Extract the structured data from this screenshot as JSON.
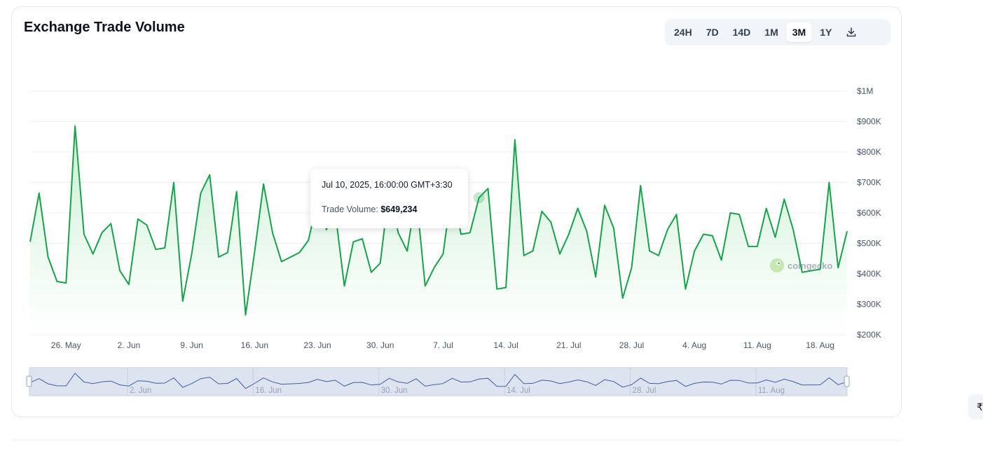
{
  "title": "Exchange Trade Volume",
  "range_buttons": [
    "24H",
    "7D",
    "14D",
    "1M",
    "3M",
    "1Y"
  ],
  "active_range": "3M",
  "tooltip": {
    "date": "Jul 10, 2025, 16:00:00 GMT+3:30",
    "label": "Trade Volume:",
    "value": "$649,234"
  },
  "watermark": "coingecko",
  "edge_glyph": "₹",
  "navigator_labels": [
    "2. Jun",
    "16. Jun",
    "30. Jun",
    "14. Jul",
    "28. Jul",
    "11. Aug"
  ],
  "colors": {
    "line": "#16a34a",
    "fill_top": "#d4f4dd",
    "navigator_bg": "#dde3ef",
    "navigator_line": "#3b5fa8"
  },
  "chart_data": {
    "type": "area",
    "series": [
      {
        "values": [
          505000,
          665000,
          455000,
          375000,
          370000,
          885000,
          530000,
          465000,
          535000,
          565000,
          410000,
          365000,
          580000,
          560000,
          480000,
          485000,
          700000,
          310000,
          465000,
          665000,
          725000,
          455000,
          470000,
          670000,
          265000,
          470000,
          695000,
          535000,
          440000,
          455000,
          470000,
          510000,
          640000,
          545000,
          600000,
          360000,
          505000,
          515000,
          405000,
          435000,
          680000,
          535000,
          475000,
          660000,
          360000,
          420000,
          465000,
          680000,
          530000,
          535000,
          650000,
          680000,
          350000,
          355000,
          840000,
          460000,
          475000,
          605000,
          570000,
          465000,
          530000,
          615000,
          540000,
          390000,
          625000,
          550000,
          320000,
          420000,
          690000,
          475000,
          460000,
          545000,
          595000,
          350000,
          475000,
          530000,
          525000,
          445000,
          600000,
          595000,
          490000,
          490000,
          615000,
          520000,
          645000,
          545000,
          405000,
          410000,
          415000,
          700000,
          420000,
          540000
        ]
      }
    ],
    "x_start": "2025-05-22",
    "x_end": "2025-08-21",
    "x_ticks": [
      "26. May",
      "2. Jun",
      "9. Jun",
      "16. Jun",
      "23. Jun",
      "30. Jun",
      "7. Jul",
      "14. Jul",
      "21. Jul",
      "28. Jul",
      "4. Aug",
      "11. Aug",
      "18. Aug"
    ],
    "y_ticks": [
      "$200K",
      "$300K",
      "$400K",
      "$500K",
      "$600K",
      "$700K",
      "$800K",
      "$900K",
      "$1M"
    ],
    "ylim": [
      200000,
      1000000
    ],
    "highlight_index": 50,
    "grid": true
  }
}
